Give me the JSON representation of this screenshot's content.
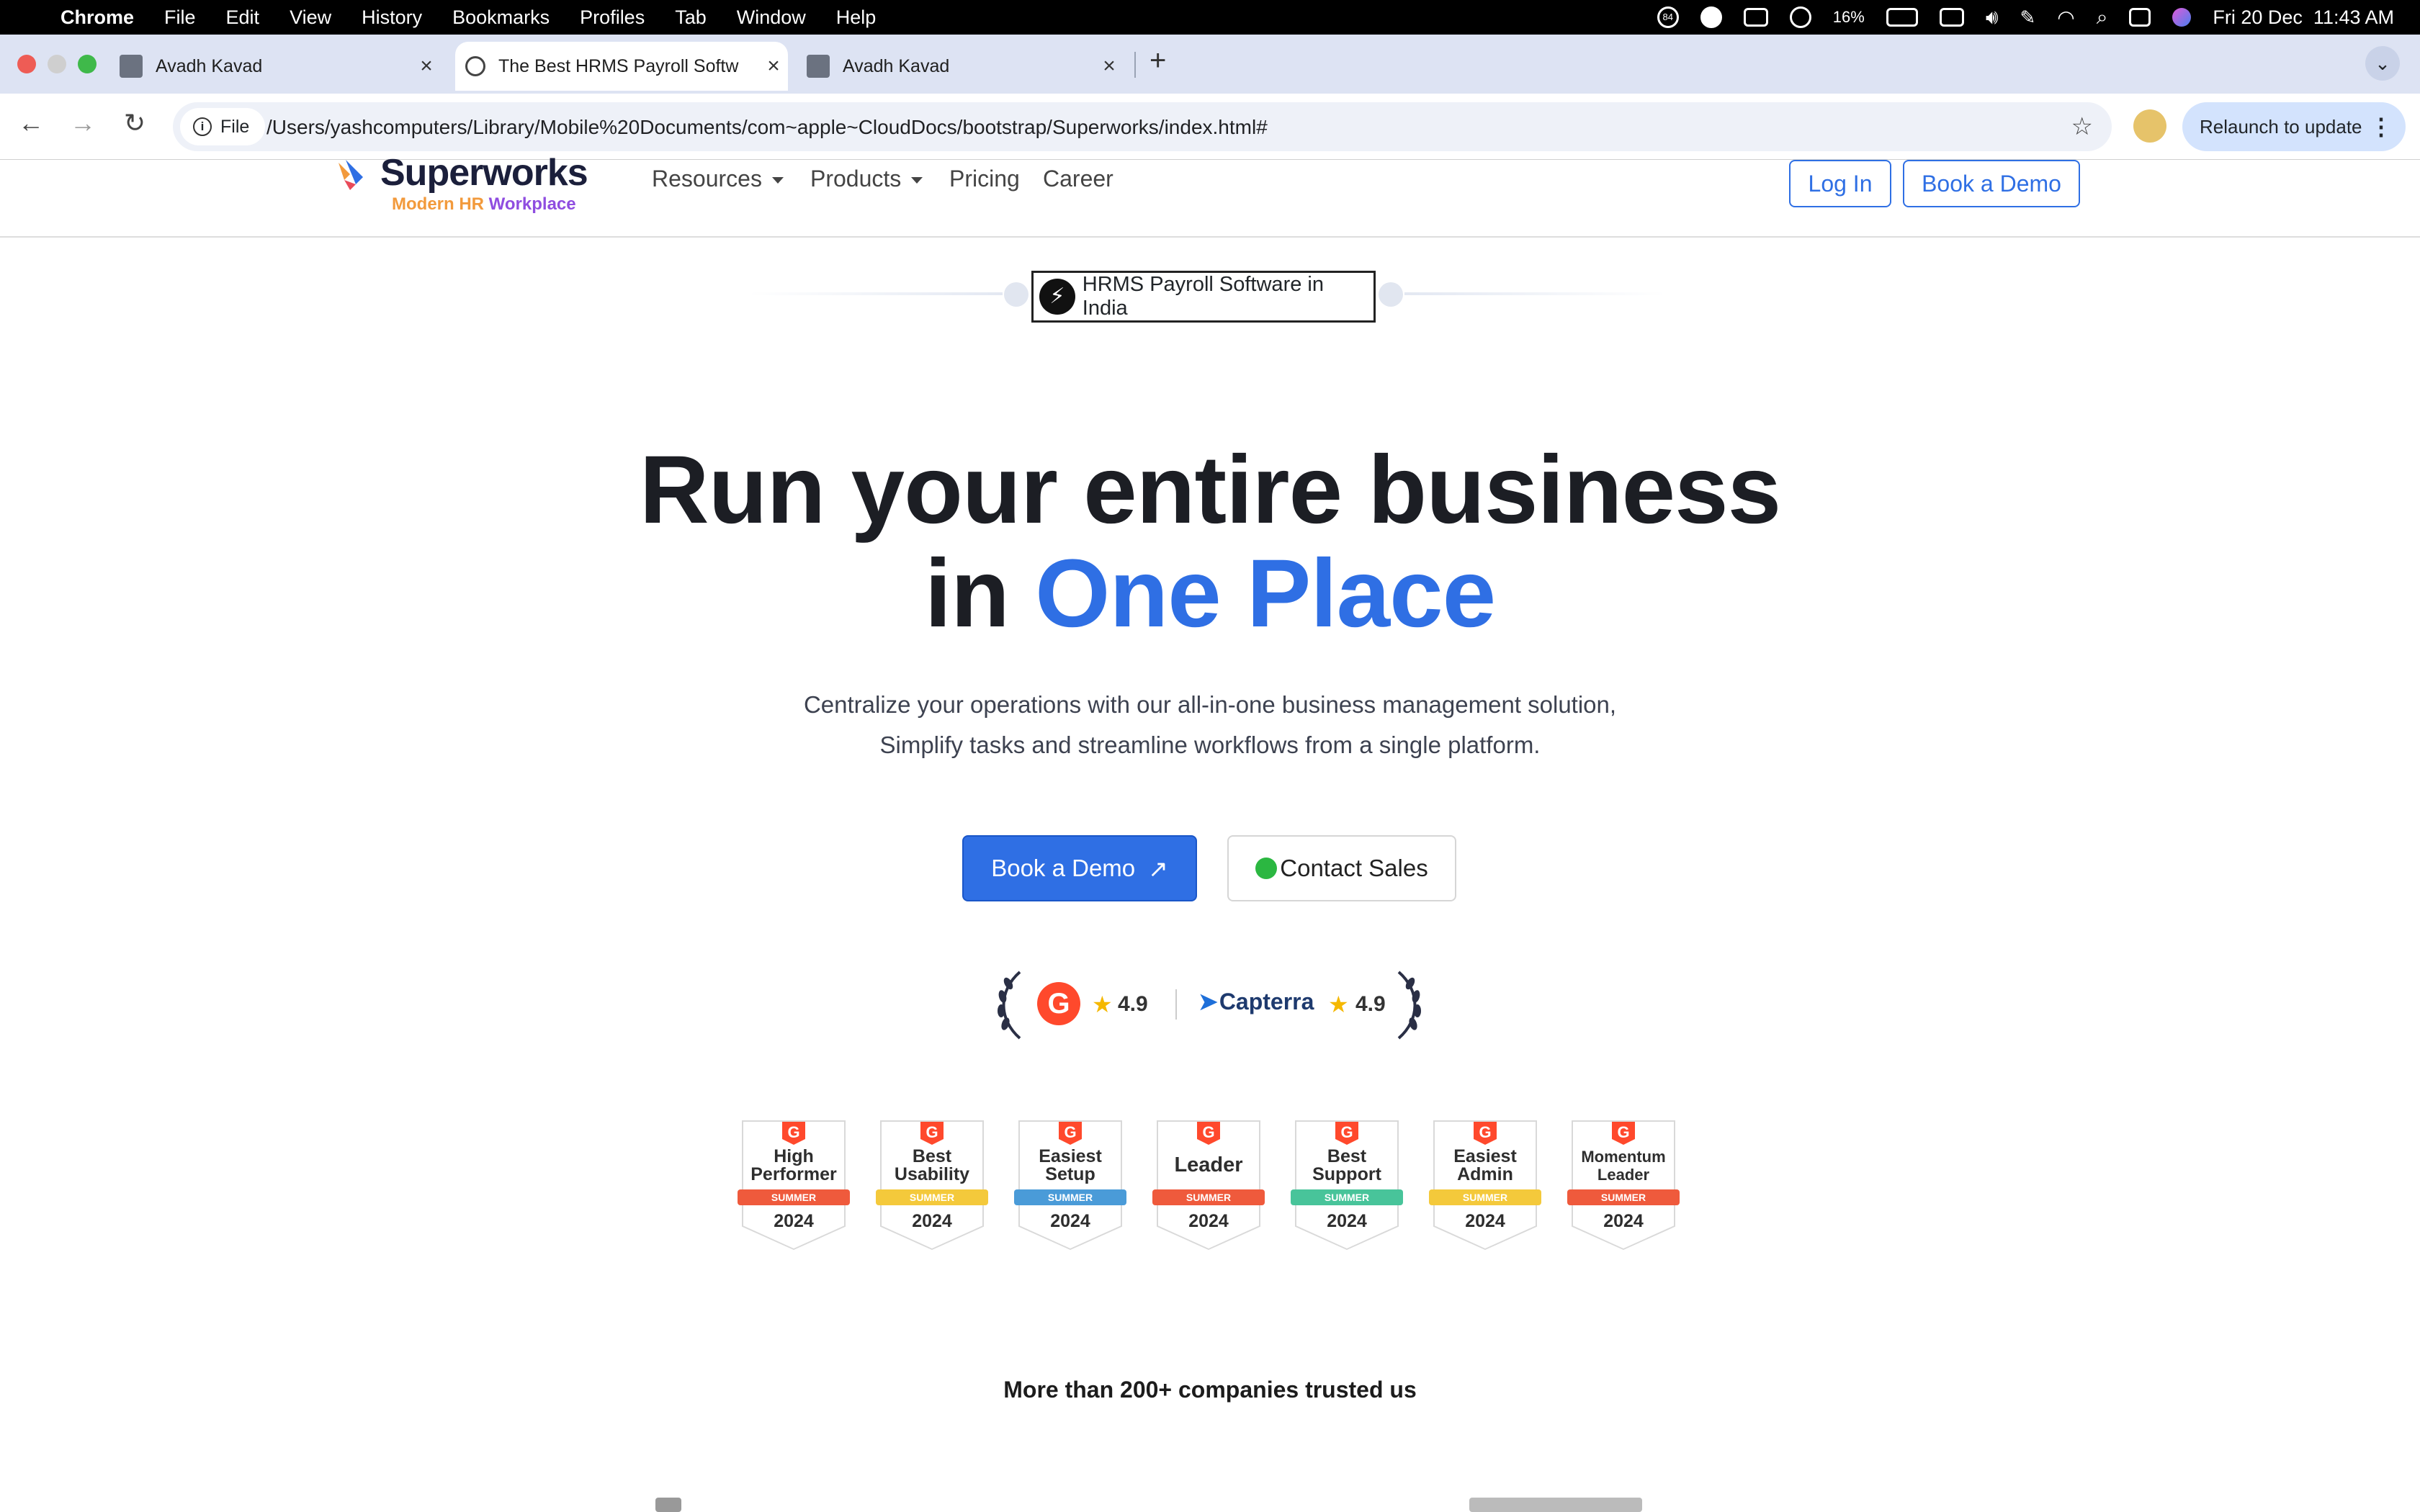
{
  "menubar": {
    "app": "Chrome",
    "items": [
      "File",
      "Edit",
      "View",
      "History",
      "Bookmarks",
      "Profiles",
      "Tab",
      "Window",
      "Help"
    ],
    "battery": "16%",
    "datetime": "Fri 20 Dec  11:43 AM",
    "badge_count": "84"
  },
  "tabs": [
    {
      "title": "Avadh Kavad",
      "active": false
    },
    {
      "title": "The Best HRMS Payroll Softw",
      "active": true
    },
    {
      "title": "Avadh Kavad",
      "active": false
    }
  ],
  "toolbar": {
    "chip": "File",
    "url": "/Users/yashcomputers/Library/Mobile%20Documents/com~apple~CloudDocs/bootstrap/Superworks/index.html#",
    "relaunch": "Relaunch to update"
  },
  "site": {
    "logo_word": "Superworks",
    "logo_tag_a": "Modern HR ",
    "logo_tag_b": "Workplace",
    "nav": {
      "resources": "Resources",
      "products": "Products",
      "pricing": "Pricing",
      "career": "Career"
    },
    "login": "Log In",
    "book_demo_header": "Book a Demo"
  },
  "hero": {
    "pill": "HRMS Payroll Software in India",
    "title_line1": "Run your entire business",
    "title_in": "in ",
    "title_highlight": "One Place",
    "sub1": "Centralize your operations with our all-in-one business management solution,",
    "sub2": "Simplify tasks and streamline workflows from a single platform.",
    "cta_primary": "Book a Demo",
    "cta_primary_icon": "↗",
    "cta_secondary": "Contact Sales"
  },
  "ratings": {
    "g2_score": "4.9",
    "capterra_name": "Capterra",
    "capterra_score": "4.9"
  },
  "badges": [
    {
      "l1": "High",
      "l2": "Performer",
      "season": "SUMMER",
      "year": "2024",
      "color": "#ef5a3c"
    },
    {
      "l1": "Best",
      "l2": "Usability",
      "season": "SUMMER",
      "year": "2024",
      "color": "#f4c93b"
    },
    {
      "l1": "Easiest",
      "l2": "Setup",
      "season": "SUMMER",
      "year": "2024",
      "color": "#4a9bd8"
    },
    {
      "l1": "Leader",
      "l2": "",
      "season": "SUMMER",
      "year": "2024",
      "color": "#ef5a3c"
    },
    {
      "l1": "Best",
      "l2": "Support",
      "season": "SUMMER",
      "year": "2024",
      "color": "#48c49a"
    },
    {
      "l1": "Easiest",
      "l2": "Admin",
      "season": "SUMMER",
      "year": "2024",
      "color": "#f4c93b"
    },
    {
      "l1": "Momentum",
      "l2": "Leader",
      "season": "SUMMER",
      "year": "2024",
      "color": "#ef5a3c"
    }
  ],
  "trust": "More than 200+ companies trusted us"
}
